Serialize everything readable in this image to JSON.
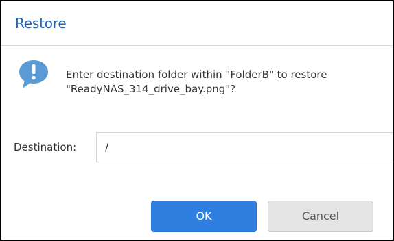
{
  "dialog": {
    "title": "Restore",
    "icon": "info-speech-bubble-icon",
    "message_line1": "Enter destination folder within \"FolderB\" to restore",
    "message_line2": "\"ReadyNAS_314_drive_bay.png\"?"
  },
  "destination": {
    "label": "Destination:",
    "value": "/"
  },
  "buttons": {
    "ok_label": "OK",
    "cancel_label": "Cancel"
  },
  "colors": {
    "title": "#1f63b3",
    "icon": "#5b9bd5",
    "ok_button": "#2e7fe0",
    "cancel_button": "#e4e4e4"
  }
}
